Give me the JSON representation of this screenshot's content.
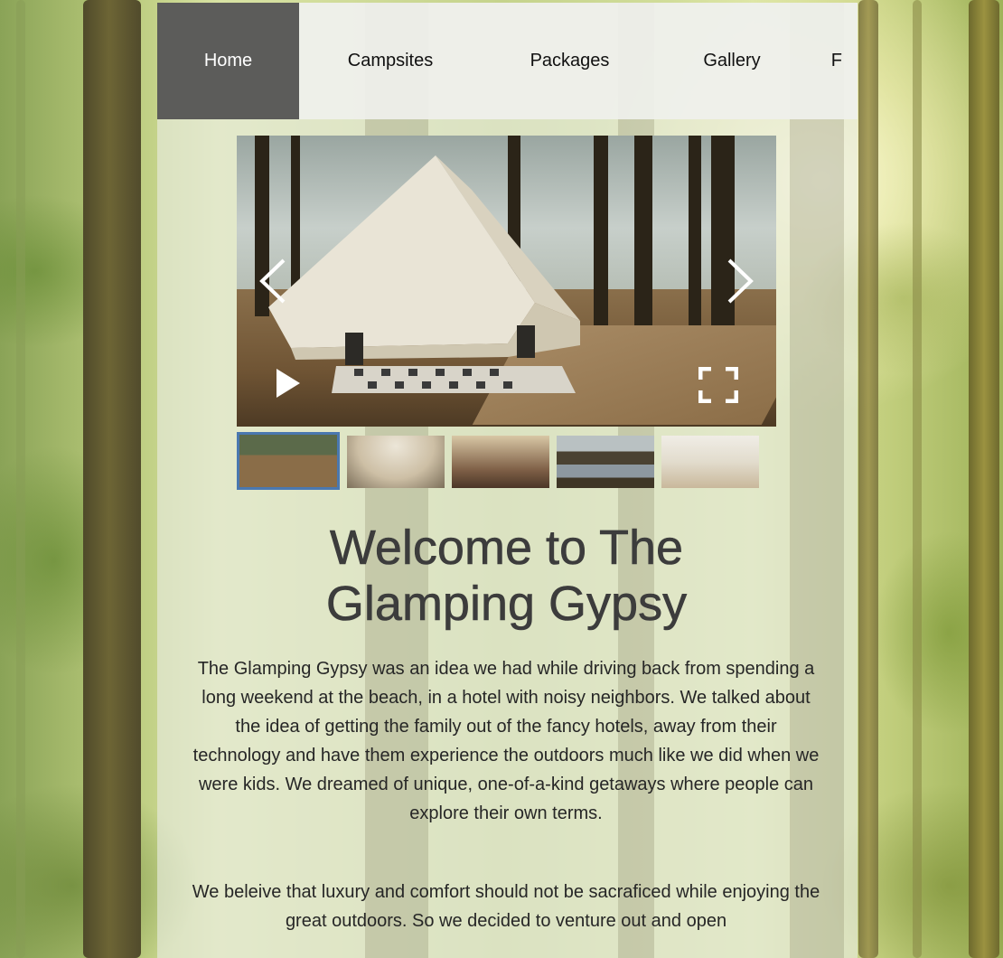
{
  "nav": {
    "items": [
      {
        "label": "Home",
        "active": true
      },
      {
        "label": "Campsites",
        "active": false
      },
      {
        "label": "Packages",
        "active": false
      },
      {
        "label": "Gallery",
        "active": false
      },
      {
        "label": "F",
        "active": false
      }
    ]
  },
  "slideshow": {
    "prev_icon": "chevron-left-icon",
    "next_icon": "chevron-right-icon",
    "play_icon": "play-icon",
    "fullscreen_icon": "fullscreen-icon",
    "thumbnail_count": 5,
    "active_thumbnail": 1
  },
  "main": {
    "title": "Welcome to The Glamping Gypsy",
    "paragraph1": "The Glamping Gypsy was an idea we had while driving back from spending a long weekend at the beach, in a hotel with noisy neighbors. We talked about the idea of getting the family out of the fancy hotels, away from their technology and have them experience the outdoors much like we did when we were kids. We dreamed of unique, one-of-a-kind getaways where people can explore their own terms.",
    "paragraph2": "We beleive that luxury and comfort should not be sacraficed while enjoying the great outdoors. So we decided to venture out and open"
  },
  "colors": {
    "nav_active_bg": "#5c5c5a",
    "thumb_active_border": "#4a78b0",
    "title_text": "#3c3c3c"
  }
}
